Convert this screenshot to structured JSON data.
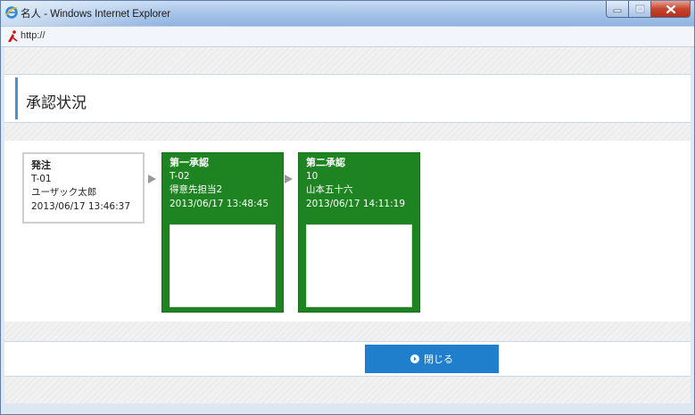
{
  "window": {
    "title": "名人 - Windows Internet Explorer",
    "address": "http://"
  },
  "page": {
    "title": "承認状況"
  },
  "flow": [
    {
      "title": "発注",
      "code": "T-01",
      "name": "ユーザック太郎",
      "datetime": "2013/06/17 13:46:37"
    },
    {
      "title": "第一承認",
      "code": "T-02",
      "name": "得意先担当2",
      "datetime": "2013/06/17 13:48:45"
    },
    {
      "title": "第二承認",
      "code": "10",
      "name": "山本五十六",
      "datetime": "2013/06/17 14:11:19"
    }
  ],
  "actions": {
    "close_label": "閉じる"
  },
  "colors": {
    "approved": "#1e8421",
    "button": "#1f7fcd",
    "accent": "#4f8fcf"
  },
  "icons": {
    "browser": "ie-logo-icon",
    "address": "page-icon",
    "flow_arrow": "arrow-right-icon",
    "close": "circle-arrow-icon"
  }
}
